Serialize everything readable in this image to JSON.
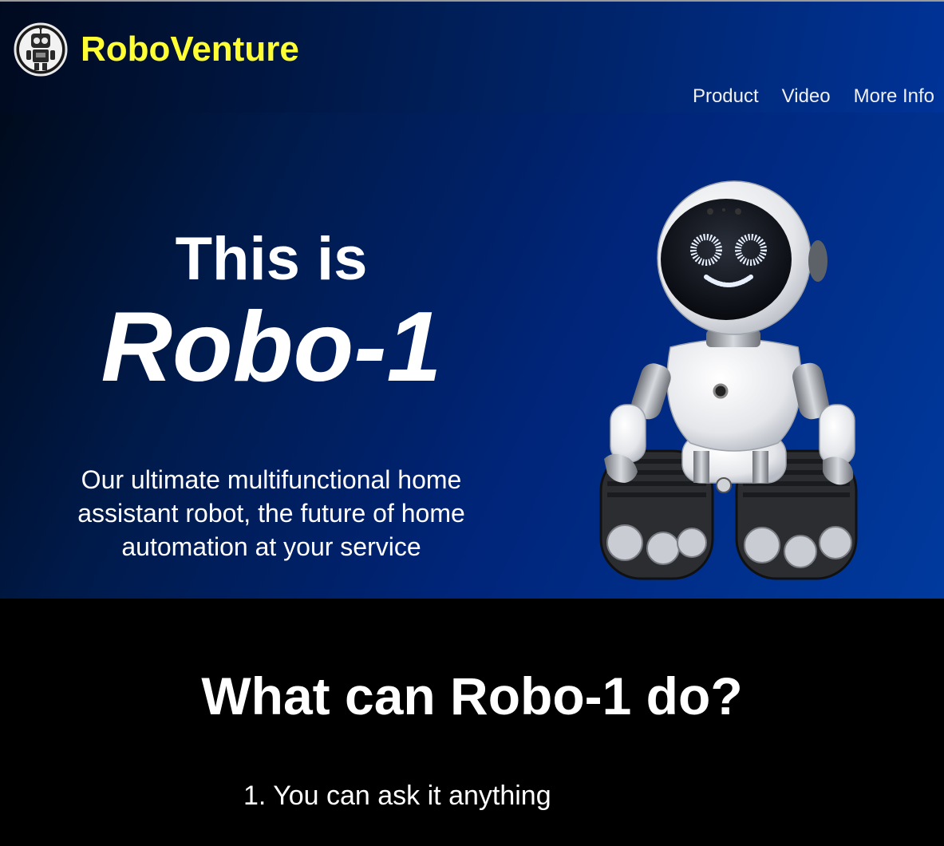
{
  "header": {
    "brand": "RoboVenture",
    "logo_icon": "robot-logo-icon"
  },
  "nav": {
    "items": [
      {
        "label": "Product"
      },
      {
        "label": "Video"
      },
      {
        "label": "More Info"
      }
    ]
  },
  "hero": {
    "title_line1": "This is",
    "title_line2": "Robo-1",
    "tagline": "Our ultimate multifunctional home assistant robot, the future of home automation at your service",
    "image_icon": "robo-1-robot-image"
  },
  "features": {
    "title": "What can Robo-1 do?",
    "items": [
      {
        "label": "1. You can ask it anything"
      }
    ]
  },
  "colors": {
    "brand": "#ffff33",
    "hero_bg": "#00257a",
    "page_bg": "#000000",
    "text": "#ffffff"
  }
}
